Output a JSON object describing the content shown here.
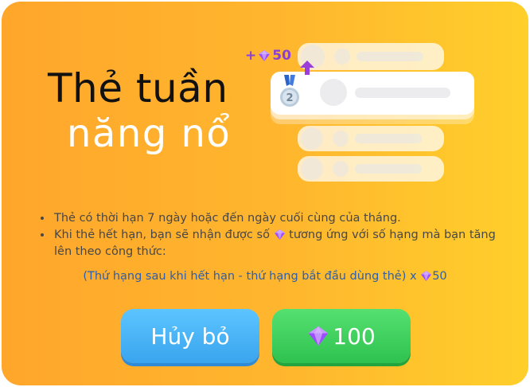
{
  "title": {
    "line1": "Thẻ tuần",
    "line2": "năng nổ"
  },
  "illustration": {
    "bonus_prefix": "+",
    "bonus_value": "50",
    "medal_rank": "2",
    "gem_icon": "purple-gem-icon",
    "colors": {
      "gem": "#9b4dff",
      "arrow": "#9b3fd8",
      "medal": "#a9c4dc"
    }
  },
  "info": {
    "bullet1": "Thẻ có thời hạn 7 ngày hoặc đến ngày cuối cùng của tháng.",
    "bullet2_part1": "Khi thẻ hết hạn, bạn sẽ nhận được số",
    "bullet2_part2": "tương ứng với số hạng mà bạn tăng lên theo công thức:",
    "formula_text": "(Thứ hạng sau khi hết hạn - thứ hạng bắt đầu dùng thẻ) x",
    "formula_value": "50"
  },
  "buttons": {
    "cancel_label": "Hủy bỏ",
    "buy_value": "100"
  },
  "colors": {
    "background_left": "#ffa62b",
    "background_right": "#ffcf2b",
    "cancel_button": "#4bb4f8",
    "buy_button": "#3fd15f",
    "formula_text": "#2d5fab"
  }
}
